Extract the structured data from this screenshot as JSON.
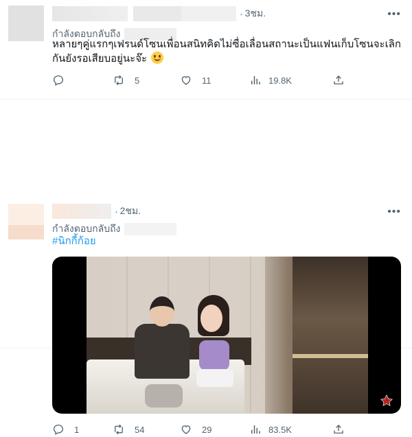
{
  "tweets": [
    {
      "time": "3ชม.",
      "replying_label": "กำลังตอบกลับถึง",
      "text": "หลายๆคู่แรกๆเฟรนด์โซนเพื่อนสนิทคิดไม่ซื่อเลื่อนสถานะเป็นแฟนเก็บโซนจะเลิกกันยังรอเสียบอยู่นะจ๊ะ",
      "emoji": "slightly-smiling-face",
      "actions": {
        "reply": "",
        "retweet": "5",
        "like": "11",
        "views": "19.8K"
      }
    },
    {
      "time": "2ชม.",
      "replying_label": "กำลังตอบกลับถึง",
      "text": "#นิกกี้ก้อย",
      "media": "video-thumbnail",
      "actions": {
        "reply": "1",
        "retweet": "54",
        "like": "29",
        "views": "83.5K"
      }
    }
  ],
  "colors": {
    "link": "#1d9bf0",
    "muted": "#536471",
    "text": "#0f1419"
  }
}
